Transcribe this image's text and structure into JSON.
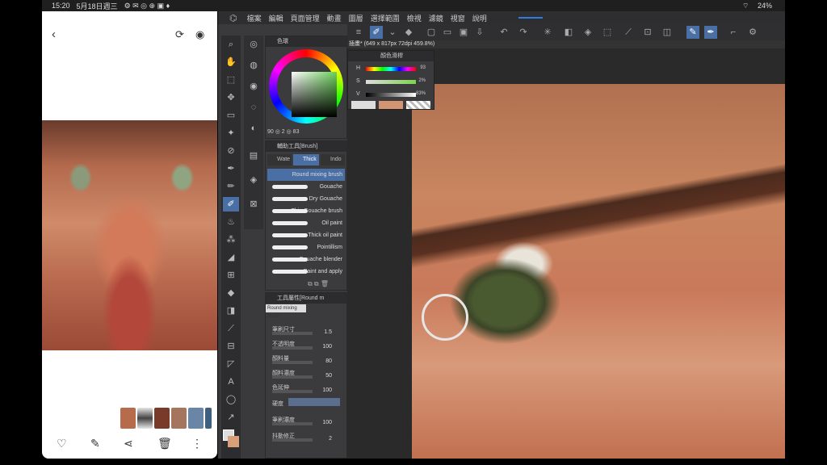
{
  "statusbar": {
    "time": "15:20",
    "date": "5月18日週三",
    "battery": "24%"
  },
  "gallery": {
    "icons": {
      "back": "chevron-left-icon",
      "rotate": "rotate-icon",
      "view": "eye-icon"
    },
    "actions": {
      "favorite": "heart-icon",
      "edit": "pencil-icon",
      "share": "share-icon",
      "delete": "trash-icon",
      "more": "more-vertical-icon"
    },
    "thumb_colors": [
      "#b56b4c",
      "#e6e6e6",
      "#7a3a2a",
      "#a6755e",
      "#6a86a6",
      "#3e5f7d"
    ]
  },
  "menubar": {
    "items": [
      "檔案",
      "編輯",
      "頁面管理",
      "動畫",
      "圖層",
      "選擇範圍",
      "檢視",
      "濾鏡",
      "視窗",
      "說明"
    ]
  },
  "color_wheel": {
    "title": "色環",
    "readout": "90 ◎ 2 ◎ 83"
  },
  "subtool": {
    "title": "輔助工具[Brush]",
    "tabs": [
      "Wate",
      "Thick",
      "Indo"
    ],
    "brushes": [
      "Round mixing brush",
      "Gouache",
      "Dry Gouache",
      "Thin Gouache brush",
      "Oil paint",
      "Thick oil paint",
      "Pointillism",
      "Gouache blender",
      "Paint and apply"
    ]
  },
  "tool_property": {
    "title": "工具屬性[Round m",
    "brush_name": "Round mixing brush",
    "props": [
      {
        "label": "筆刷尺寸",
        "value": "1.5"
      },
      {
        "label": "不透明度",
        "value": "100"
      },
      {
        "label": "顏料量",
        "value": "80"
      },
      {
        "label": "顏料濃度",
        "value": "50"
      },
      {
        "label": "色延伸",
        "value": "100"
      },
      {
        "label": "硬度",
        "value": ""
      },
      {
        "label": "筆刷濃度",
        "value": "100"
      },
      {
        "label": "抖動修正",
        "value": "2"
      }
    ]
  },
  "document": {
    "tab": "插畫* (649 x 817px 72dpi 459.8%)"
  },
  "color_mixer": {
    "title": "顏色滑桿",
    "rows": [
      {
        "label": "H",
        "value": "93"
      },
      {
        "label": "S",
        "value": "2%"
      },
      {
        "label": "V",
        "value": "83%"
      }
    ],
    "side_label": "HSV RGB CMYK"
  }
}
